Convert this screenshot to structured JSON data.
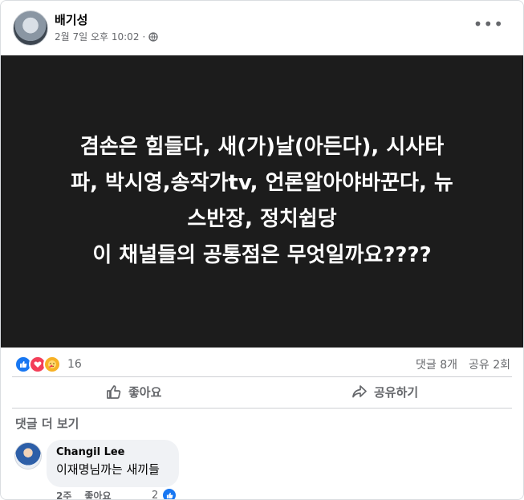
{
  "post": {
    "author": "배기성",
    "timestamp": "2월 7일 오후 10:02",
    "separator": "·",
    "more_label": "•••",
    "text": "겸손은 힘들다, 새(가)날(아든다), 시사타\n파, 박시영,송작가tv, 언론알아야바꾼다, 뉴\n스반장, 정치쉽당\n이 채널들의 공통점은 무엇일까요????",
    "background_color": "#1c1c1c"
  },
  "stats": {
    "reaction_count": "16",
    "comments": "댓글 8개",
    "shares": "공유 2회"
  },
  "actions": {
    "like": "좋아요",
    "share": "공유하기"
  },
  "comments_section": {
    "more_label": "댓글 더 보기",
    "comment": {
      "name": "Changil Lee",
      "text": "이재명님까는 새끼들",
      "time": "2주",
      "like": "좋아요",
      "reaction_count": "2"
    }
  },
  "colors": {
    "like_blue": "#1877f2",
    "love_red": "#f33e58",
    "care_yellow": "#f7b125",
    "muted_text": "#65676b"
  }
}
